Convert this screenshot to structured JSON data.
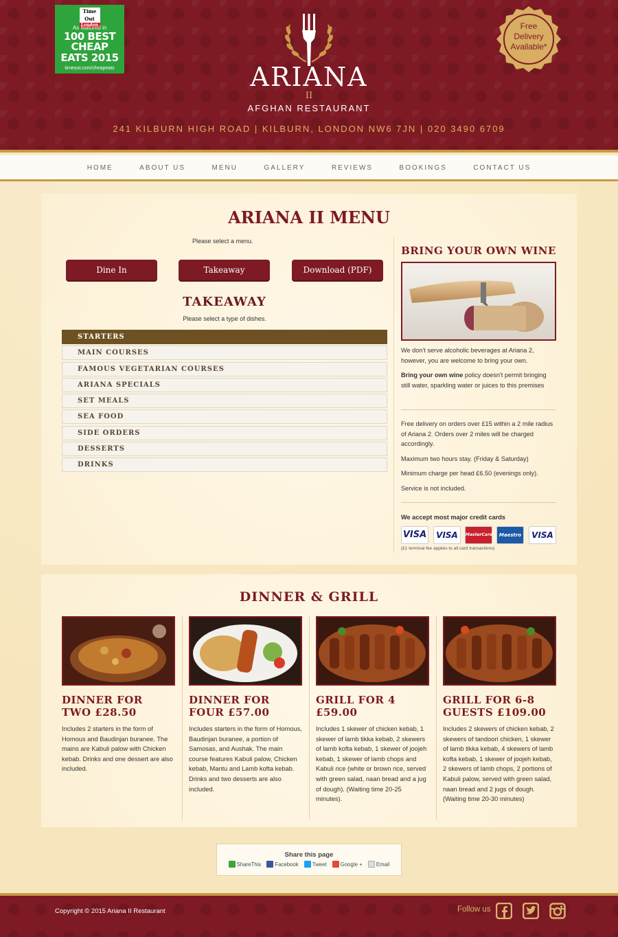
{
  "header": {
    "timeout": {
      "logo_top": "Time Out",
      "logo_bottom": "London",
      "featured": "As featured in",
      "headline_1": "100 BEST CHEAP",
      "headline_2": "EATS 2015",
      "url": "timeout.com/cheapeats"
    },
    "restaurant_name": "ARIANA",
    "restaurant_numeral": "II",
    "subtitle": "AFGHAN RESTAURANT",
    "address": "241 KILBURN HIGH ROAD | KILBURN, LONDON NW6 7JN | 020 3490 6709",
    "delivery_seal": [
      "Free",
      "Delivery",
      "Available*"
    ]
  },
  "nav": [
    "HOME",
    "ABOUT US",
    "MENU",
    "GALLERY",
    "REVIEWS",
    "BOOKINGS",
    "CONTACT US"
  ],
  "menu_section": {
    "title": "ARIANA II MENU",
    "select_note": "Please select a menu.",
    "buttons": [
      "Dine In",
      "Takeaway",
      "Download (PDF)"
    ],
    "subtitle": "TAKEAWAY",
    "dish_note": "Please select a type of dishes.",
    "categories": [
      "STARTERS",
      "MAIN COURSES",
      "FAMOUS VEGETARIAN COURSES",
      "ARIANA SPECIALS",
      "SET MEALS",
      "SEA FOOD",
      "SIDE ORDERS",
      "DESSERTS",
      "DRINKS"
    ],
    "active_category": "STARTERS"
  },
  "sidebar": {
    "byow_title": "BRING YOUR OWN WINE",
    "p1": "We don't serve alcoholic beverages at Ariana 2, however, you are welcome to bring your own.",
    "p2_bold": "Bring your own wine",
    "p2_rest": " policy doesn't permit bringing still water, sparkling water or juices to this premises",
    "p3": "Free delivery on orders over £15 within a 2 mile radius of Ariana 2. Orders over 2 miles will be charged accordingly.",
    "p4": "Maximum two hours stay. (Friday & Saturday)",
    "p5": "Minimum charge per head £6.50 (evenings only).",
    "p6": "Service is not included.",
    "cards_title": "We accept most major credit cards",
    "cards": [
      "VISA",
      "VISA",
      "MasterCard",
      "Maestro",
      "VISA"
    ],
    "card_note": "(£1 terminal fee applies to all card transactions)"
  },
  "dinner_section": {
    "title": "DINNER & GRILL",
    "dishes": [
      {
        "name": "DINNER FOR TWO £28.50",
        "desc": "Includes 2 starters in the form of Homous and Baudinjan buranee. The mains are Kabuli palow with Chicken kebab. Drinks and one dessert are also included."
      },
      {
        "name": "DINNER FOR FOUR £57.00",
        "desc": "Includes starters in the form of Homous, Baudinjan buranee, a portion of Samosas, and Aushak. The main course features Kabuli palow, Chicken kebab, Mantu and Lamb kofta kebab. Drinks and two desserts are also included."
      },
      {
        "name": "GRILL FOR 4 £59.00",
        "desc": "Includes 1 skewer of chicken kebab, 1 skewer of lamb tikka kebab, 2 skewers of lamb kofta kebab, 1 skewer of joojeh kebab, 1 skewer of lamb chops and Kabuli rice (white or brown rice, served with green salad, naan bread and a jug of dough). (Waiting time 20-25 minutes)."
      },
      {
        "name": "GRILL FOR 6-8 GUESTS £109.00",
        "desc": "Includes 2 skewers of chicken kebab, 2 skewers of tandoori chicken, 1 skewer of lamb tikka kebab, 4 skewers of lamb kofta kebab, 1 skewer of joojeh kebab, 2 skewers of lamb chops, 2 portions of Kabuli palow, served with green salad, naan bread and 2 jugs of dough. (Waiting time 20-30 minutes)"
      }
    ]
  },
  "share": {
    "title": "Share this page",
    "items": [
      "ShareThis",
      "Facebook",
      "Tweet",
      "Google +",
      "Email"
    ]
  },
  "footer": {
    "copyright": "Copyright © 2015 Ariana II Restaurant",
    "follow": "Follow us"
  },
  "colors": {
    "brand_maroon": "#7d1a24",
    "gold": "#c79a45",
    "active_category": "#6e5122"
  }
}
